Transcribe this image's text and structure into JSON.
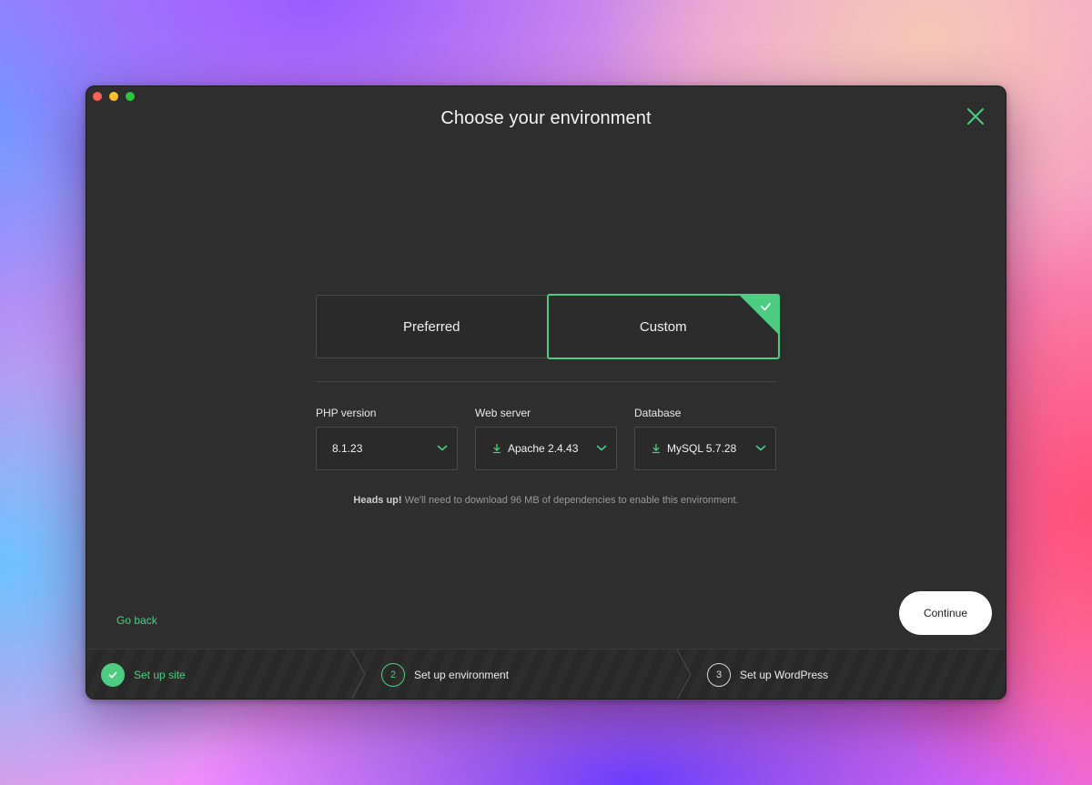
{
  "dialog": {
    "title": "Choose your environment"
  },
  "environment_toggle": {
    "preferred_label": "Preferred",
    "custom_label": "Custom",
    "selected": "Custom"
  },
  "fields": {
    "php": {
      "label": "PHP version",
      "value": "8.1.23"
    },
    "web_server": {
      "label": "Web server",
      "value": "Apache 2.4.43",
      "icon": "download-icon"
    },
    "database": {
      "label": "Database",
      "value": "MySQL 5.7.28",
      "icon": "download-icon"
    }
  },
  "notice": {
    "strong": "Heads up!",
    "text": " We'll need to download 96 MB of dependencies to enable this environment."
  },
  "actions": {
    "go_back": "Go back",
    "continue": "Continue"
  },
  "steps": [
    {
      "number": "1",
      "label": "Set up site",
      "state": "done"
    },
    {
      "number": "2",
      "label": "Set up environment",
      "state": "active"
    },
    {
      "number": "3",
      "label": "Set up WordPress",
      "state": "todo"
    }
  ],
  "colors": {
    "accent": "#4ecd82",
    "window_bg": "#2e2e2e",
    "continue_bg": "#ffffff"
  }
}
